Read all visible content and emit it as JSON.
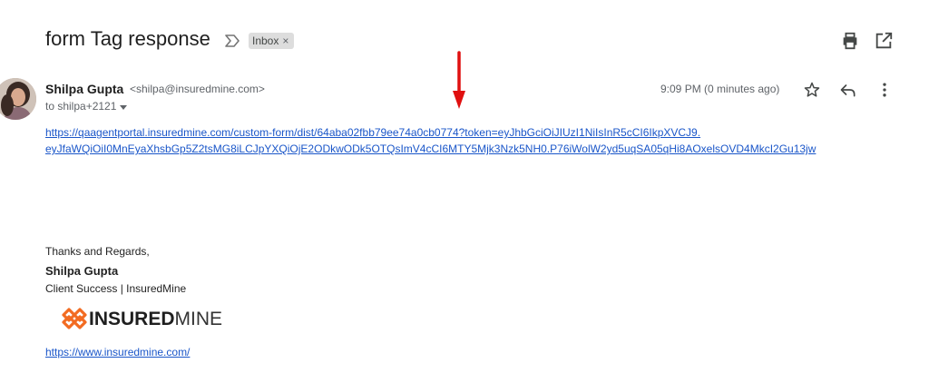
{
  "email": {
    "subject": "form Tag response",
    "label_chip": "Inbox",
    "label_chip_close": "×",
    "sender_name": "Shilpa Gupta",
    "sender_email": "<shilpa@insuredmine.com>",
    "recipient": "to shilpa+2121",
    "timestamp": "9:09 PM (0 minutes ago)",
    "link_line1": "https://qaagentportal.insuredmine.com/custom-form/dist/64aba02fbb79ee74a0cb0774?token=eyJhbGciOiJIUzI1NiIsInR5cCI6IkpXVCJ9.",
    "link_line2": "eyJfaWQiOiI0MnEyaXhsbGp5Z2tsMG8iLCJpYXQiOjE2ODkwODk5OTQsImV4cCI6MTY5Mjk3Nzk5NH0.P76iWolW2yd5uqSA05qHi8AOxelsOVD4MkcI2Gu13jw"
  },
  "signature": {
    "greeting": "Thanks and Regards,",
    "name": "Shilpa Gupta",
    "role": "Client Success | InsuredMine",
    "logo_text_bold": "INSURED",
    "logo_text_light": "MINE",
    "website": "https://www.insuredmine.com/"
  },
  "icons": {
    "importance": "importance-marker-icon",
    "print": "print-icon",
    "popout": "open-in-new-window-icon",
    "star": "star-icon",
    "reply": "reply-icon",
    "more": "more-vertical-icon",
    "caret": "caret-down-icon",
    "annotation": "red-arrow-icon"
  },
  "colors": {
    "link": "#1a56c9",
    "arrow": "#e01010",
    "logo_orange": "#f26b21",
    "chip_bg": "#dddddd"
  }
}
